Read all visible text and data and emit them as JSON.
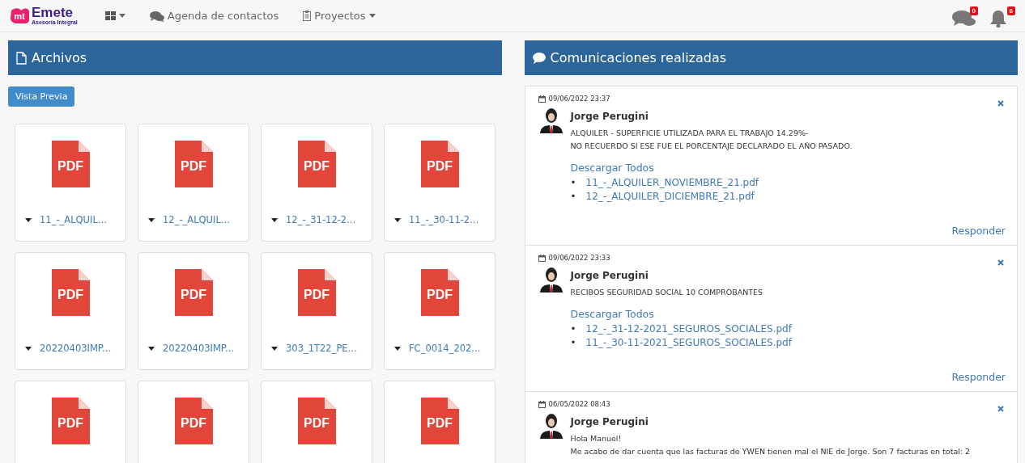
{
  "navbar": {
    "logo": {
      "mark": "mt",
      "name": "Emete",
      "tagline": "Asesoría Integral"
    },
    "items": [
      {
        "kind": "grid"
      },
      {
        "kind": "contacts",
        "label": "Agenda de contactos"
      },
      {
        "kind": "projects",
        "label": "Proyectos"
      }
    ],
    "notifications": [
      {
        "kind": "chat",
        "count": "0"
      },
      {
        "kind": "bell",
        "count": "6"
      }
    ]
  },
  "files_panel": {
    "title": "Archivos",
    "preview_button": "Vista Previa",
    "files": [
      {
        "type_label": "PDF",
        "name": "11_-_ALQUIL..."
      },
      {
        "type_label": "PDF",
        "name": "12_-_ALQUIL..."
      },
      {
        "type_label": "PDF",
        "name": "12_-_31-12-2..."
      },
      {
        "type_label": "PDF",
        "name": "11_-_30-11-2..."
      },
      {
        "type_label": "PDF",
        "name": "20220403IMP..."
      },
      {
        "type_label": "PDF",
        "name": "20220403IMP..."
      },
      {
        "type_label": "PDF",
        "name": "303_1T22_PE..."
      },
      {
        "type_label": "PDF",
        "name": "FC_0014_202..."
      },
      {
        "type_label": "PDF"
      },
      {
        "type_label": "PDF"
      },
      {
        "type_label": "PDF"
      },
      {
        "type_label": "PDF"
      }
    ]
  },
  "communications_panel": {
    "title": "Comunicaciones realizadas",
    "messages": [
      {
        "date": "09/06/2022 23:37",
        "author": "Jorge Perugini",
        "lines": [
          "ALQUILER - SUPERFICIE UTILIZADA PARA EL TRABAJO 14.29%-",
          "NO RECUERDO SI ESE FUE EL PORCENTAJE DECLARADO EL AÑO PASADO."
        ],
        "download_all": "Descargar Todos",
        "attachments": [
          {
            "bullet": "•",
            "name": "11_-_ALQUILER_NOVIEMBRE_21.pdf"
          },
          {
            "bullet": "•",
            "name": "12_-_ALQUILER_DICIEMBRE_21.pdf"
          }
        ],
        "reply": "Responder"
      },
      {
        "date": "09/06/2022 23:33",
        "author": "Jorge Perugini",
        "lines": [
          "RECIBOS SEGURIDAD SOCIAL 10 COMPROBANTES"
        ],
        "download_all": "Descargar Todos",
        "attachments": [
          {
            "bullet": "•",
            "name": "12_-_31-12-2021_SEGUROS_SOCIALES.pdf"
          },
          {
            "bullet": "•",
            "name": "11_-_30-11-2021_SEGUROS_SOCIALES.pdf"
          }
        ],
        "reply": "Responder"
      },
      {
        "date": "06/05/2022 08:43",
        "author": "Jorge Perugini",
        "lines": [
          "Hola Manuel!",
          "Me acabo de dar cuenta que las facturas de YWEN tienen mal el NIE de Jorge. Son 7 facturas en total: 2"
        ]
      }
    ]
  }
}
